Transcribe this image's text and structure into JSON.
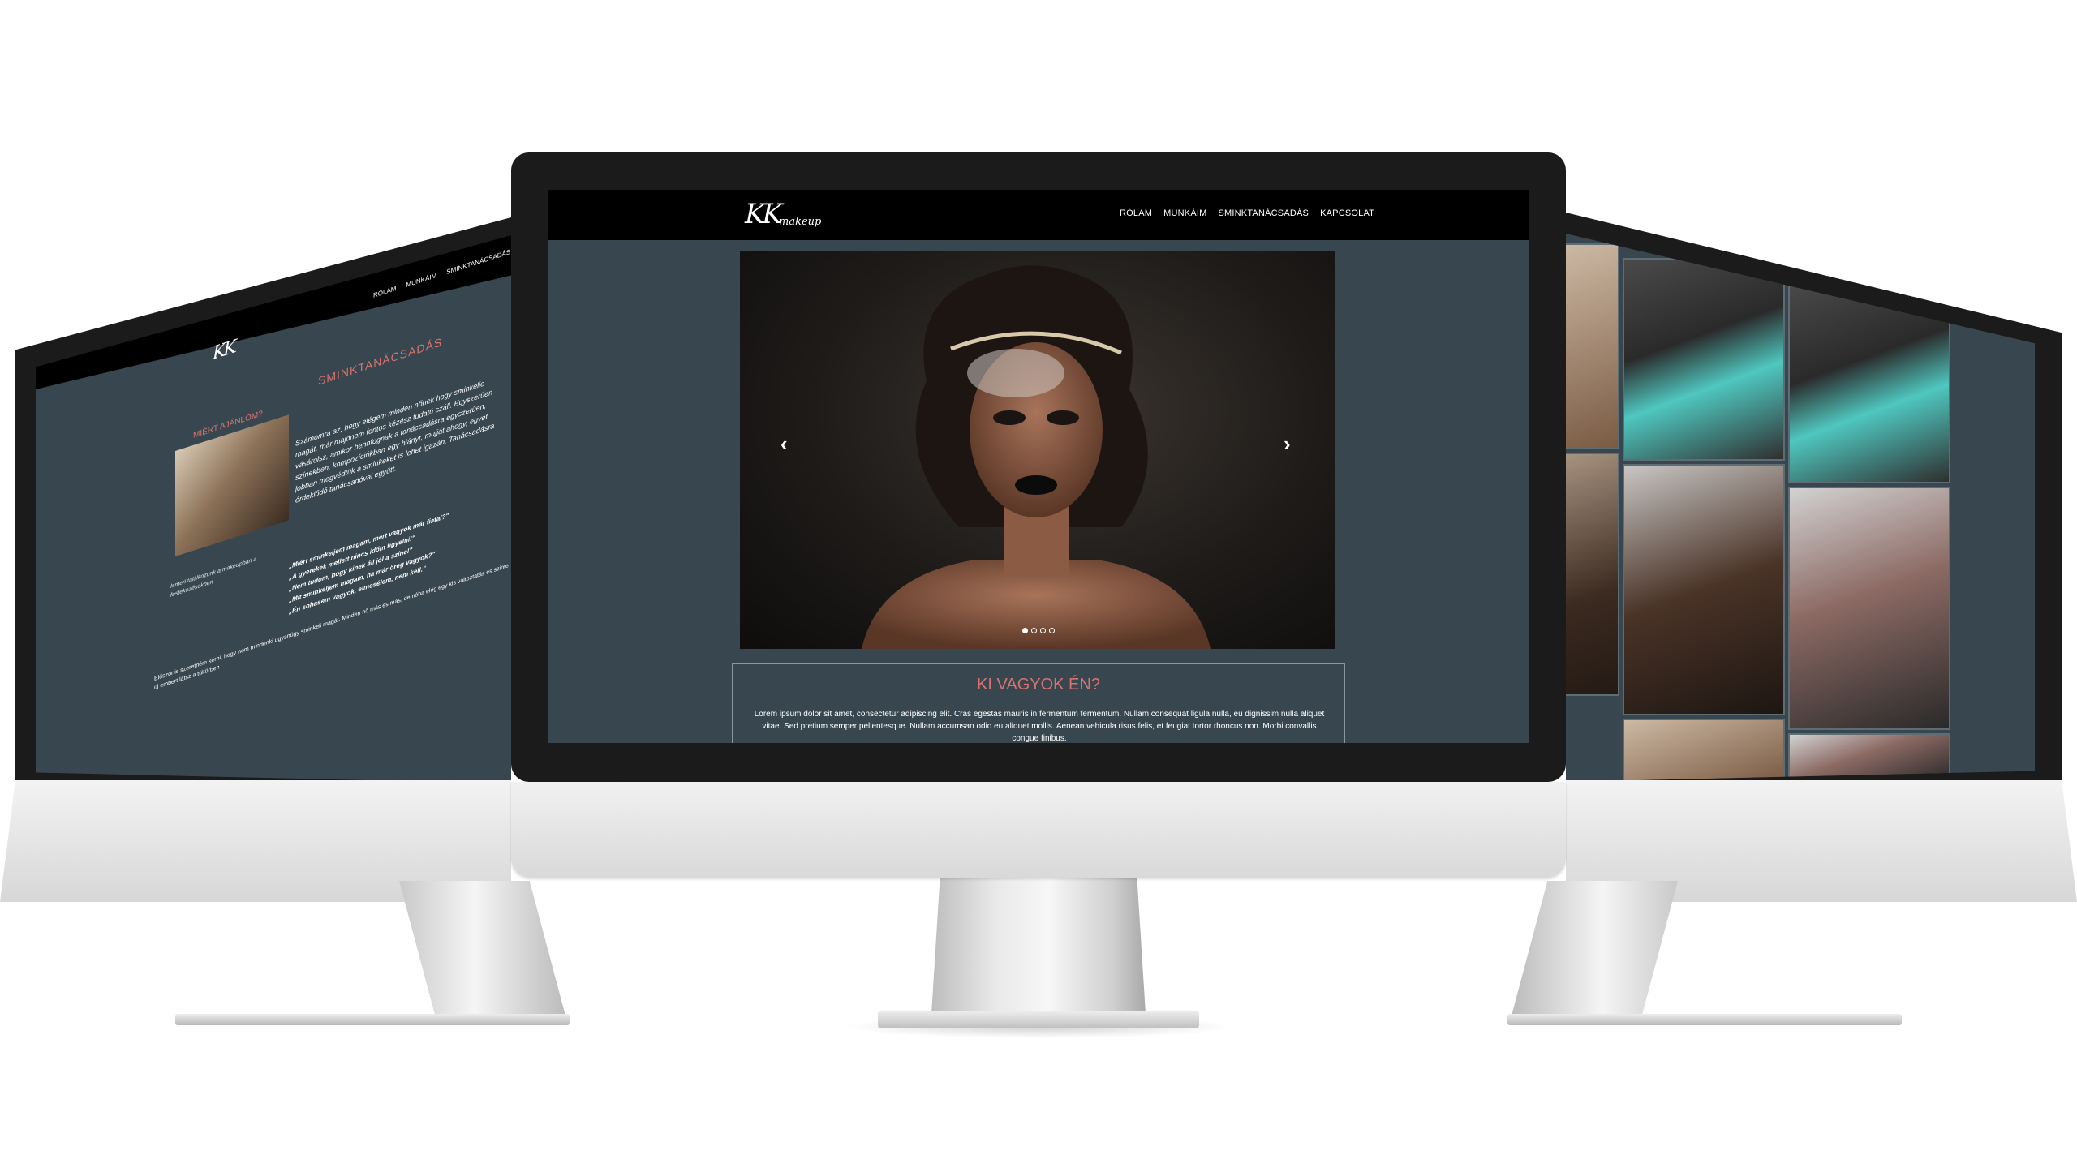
{
  "site": {
    "logo": {
      "monogram": "KK",
      "sub": "makeup"
    },
    "nav": [
      "RÓLAM",
      "MUNKÁIM",
      "SMINKTANÁCSADÁS",
      "KAPCSOLAT"
    ]
  },
  "center_screen": {
    "slider": {
      "prev_icon": "‹",
      "next_icon": "›",
      "slides_count": 4,
      "active_index": 0
    },
    "intro": {
      "title": "KI VAGYOK ÉN?",
      "text": "Lorem ipsum dolor sit amet, consectetur adipiscing elit. Cras egestas mauris in fermentum fermentum. Nullam consequat ligula nulla, eu dignissim nulla aliquet vitae. Sed pretium semper pellentesque. Nullam accumsan odio eu aliquet mollis. Aenean vehicula risus felis, et feugiat tortor rhoncus non. Morbi convallis congue finibus."
    }
  },
  "left_screen": {
    "nav": [
      "RÓLAM",
      "MUNKÁIM",
      "SMINKTANÁCSADÁS"
    ],
    "title": "SMINKTANÁCSADÁS",
    "side_heading": "MIÉRT AJÁNLOM?",
    "paragraph": "Számomra az, hogy elégem minden nőnek hogy sminkelje magát, már majdnem fontos kézész tudatú száll. Egyszerűen vásárolsz, amikor bennfognak a tanácsadásra egyszerűen, színekben, kompozíciókban egy hiányt, mujját ahogy, egyet jobban megvédtük a sminkeket is lehet igazán. Tanácsadásra érdeklődő tanácsadóval együtt.",
    "caption": "Ismeri találkozunk a makeupban a festekezésekben",
    "quotes": [
      "„Miért sminkeljem magam, mert vagyok már fiatal?\"",
      "„A gyerekek mellett nincs időm figyelni!\"",
      "„Nem tudom, hogy kinek áll jól a színe!\"",
      "„Mit sminkeljem magam, ha már öreg vagyok?\"",
      "„Én sohasem vagyok, elmesélem, nem kell.\""
    ],
    "body": "Először is szeretném kérni, hogy nem mindenki ugyanúgy sminkeli magát. Minden nő más és más, de néha elég egy kis változtatás és szinte új embert látsz a tükörben."
  }
}
